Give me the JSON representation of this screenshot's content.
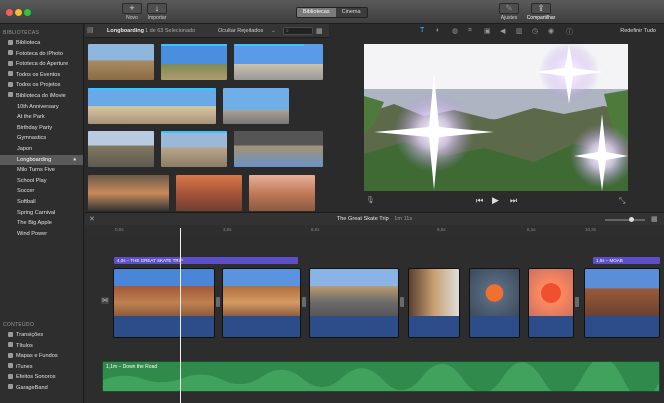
{
  "toolbar": {
    "new_label": "Novo",
    "import_label": "Importar",
    "tabs": [
      {
        "label": "Bibliotecas",
        "active": true
      },
      {
        "label": "Cinema",
        "active": false
      }
    ],
    "adjust_label": "Ajustes",
    "share_label": "Compartilhar"
  },
  "sidebar": {
    "libraries_header": "BIBLIOTECAS",
    "library_items": [
      {
        "label": "Biblioteca",
        "sub": false
      },
      {
        "label": "Fototeca do iPhoto",
        "sub": false
      },
      {
        "label": "Fototeca do Aperture",
        "sub": false
      },
      {
        "label": "Todos os Eventos",
        "sub": false
      },
      {
        "label": "Todos os Projetos",
        "sub": false
      },
      {
        "label": "Biblioteca do iMovie",
        "sub": false
      },
      {
        "label": "10th Anniversary",
        "sub": true
      },
      {
        "label": "At the Park",
        "sub": true
      },
      {
        "label": "Birthday Party",
        "sub": true
      },
      {
        "label": "Gymnastics",
        "sub": true
      },
      {
        "label": "Japon",
        "sub": true
      },
      {
        "label": "Longboarding",
        "sub": true,
        "selected": true
      },
      {
        "label": "Milo Turns Five",
        "sub": true
      },
      {
        "label": "School Play",
        "sub": true
      },
      {
        "label": "Soccer",
        "sub": true
      },
      {
        "label": "Softball",
        "sub": true
      },
      {
        "label": "Spring Carnival",
        "sub": true
      },
      {
        "label": "The Big Apple",
        "sub": true
      },
      {
        "label": "Wind Power",
        "sub": true
      }
    ],
    "content_header": "CONTEÚDO",
    "content_items": [
      "Transições",
      "Títulos",
      "Mapas e Fundos",
      "iTunes",
      "Efeitos Sonoros",
      "GarageBand"
    ]
  },
  "browser": {
    "event_name": "Longboarding",
    "selection_count": "1 de 63 Selecionado",
    "filter_label": "Ocultar Rejeitados"
  },
  "viewer": {
    "reset_label": "Redefinir Tudo"
  },
  "timeline": {
    "project_title": "The Great Skate Trip",
    "project_duration": "1m 11s",
    "ruler_marks": [
      "0,0s",
      "3,0s",
      "6,0s",
      "9,0s",
      "6,1s",
      "10,3s"
    ],
    "title_clips": [
      {
        "label": "4,0s – THE GREAT SKATE TRIP"
      },
      {
        "label": "1,5s – MOAB"
      }
    ],
    "audio_label": "1,1m – Down the Road"
  },
  "colors": {
    "selection_blue": "#38c5ff",
    "title_purple": "#5d4fc9",
    "audio_green": "#2f8a4c",
    "clip_blue": "#2c4c8a"
  }
}
